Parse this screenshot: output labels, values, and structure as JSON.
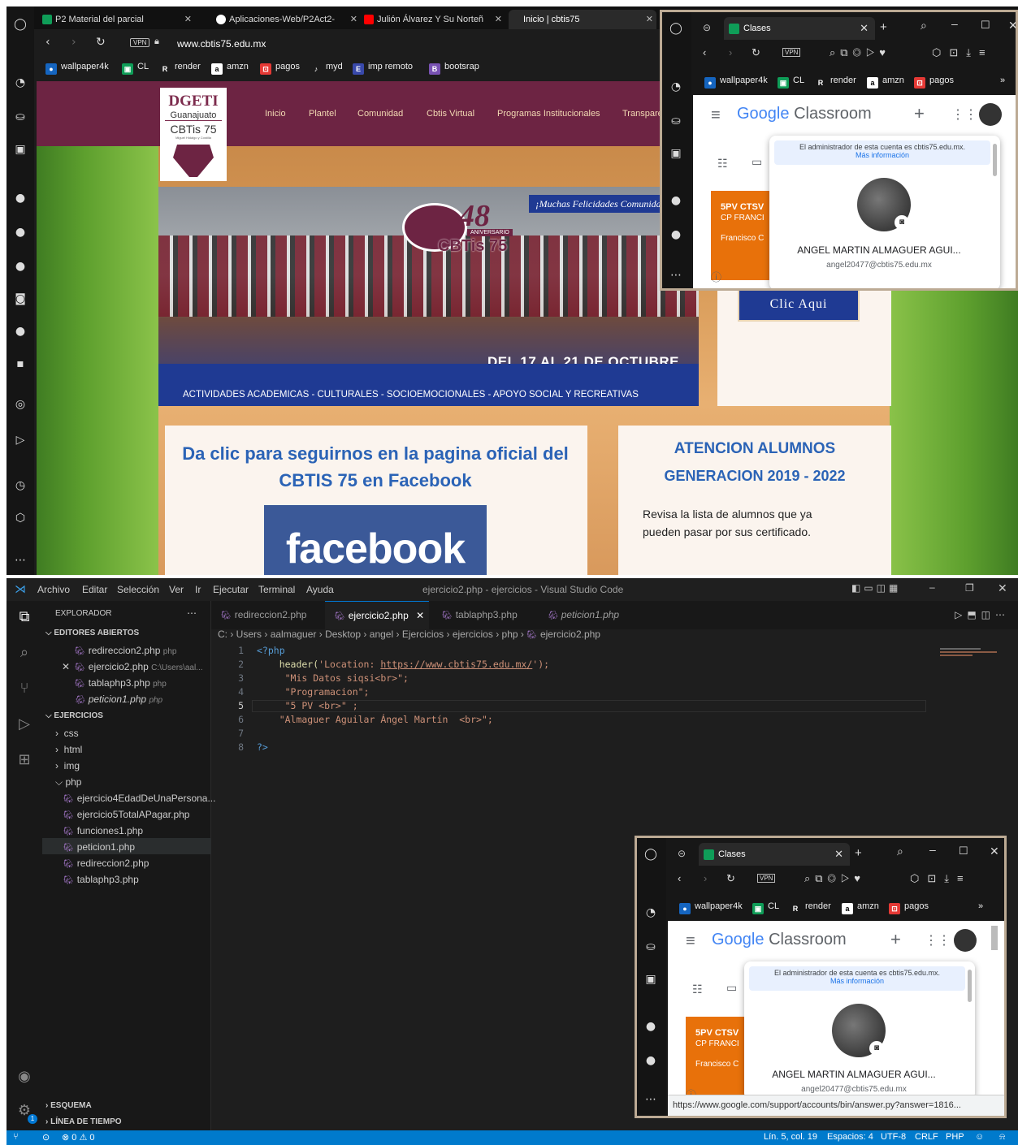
{
  "browser": {
    "tabs": [
      {
        "label": "P2 Material del parcial"
      },
      {
        "label": "Aplicaciones-Web/P2Act2-"
      },
      {
        "label": "Julión Álvarez Y Su Norteñ"
      },
      {
        "label": "Inicio | cbtis75"
      }
    ],
    "vpn": "VPN",
    "url": "www.cbtis75.edu.mx",
    "bookmarks": [
      "wallpaper4k",
      "CL",
      "render",
      "amzn",
      "pagos",
      "myd",
      "imp remoto",
      "bootsrap"
    ]
  },
  "site": {
    "logo_line1": "DGETI",
    "logo_line2": "Guanajuato",
    "logo_line3": "CBTis 75",
    "logo_line4": "Miguel Hidalgo y Costilla",
    "nav": [
      "Inicio",
      "Plantel",
      "Comunidad",
      "Cbtis Virtual",
      "Programas Institucionales",
      "Transpare"
    ],
    "banner_script": "¡Muchas Felicidades Comunidad",
    "banner_badge_number": "48",
    "banner_badge_text": "ANIVERSARIO",
    "banner_badge_school": "CBTis 75",
    "banner_dates": "DEL 17 AL 21 DE OCTUBRE",
    "banner_strip": "ACTIVIDADES ACADEMICAS - CULTURALES - SOCIOEMOCIONALES - APOYO SOCIAL Y RECREATIVAS",
    "clic_button": "Clic Aqui",
    "facebook_card_title": "Da clic para seguirnos en la pagina oficial del CBTIS 75 en Facebook",
    "facebook_logo": "facebook",
    "alumnos_title_1": "ATENCION ALUMNOS",
    "alumnos_title_2": "GENERACION 2019 - 2022",
    "alumnos_text": "Revisa la lista de alumnos que ya pueden pasar por sus certificado."
  },
  "mini_top": {
    "tab": "Clases",
    "vpn": "VPN",
    "bookmarks": [
      "wallpaper4k",
      "CL",
      "render",
      "amzn",
      "pagos"
    ],
    "app_google": "Google",
    "app_name": "Classroom",
    "admin_notice": "El administrador de esta cuenta es cbtis75.edu.mx.",
    "more_info": "Más información",
    "card_line1": "5PV CTSV",
    "card_line2": "CP FRANCI",
    "card_line3": "Francisco C",
    "user_name": "ANGEL MARTIN ALMAGUER AGUI...",
    "user_email": "angel20477@cbtis75.edu.mx"
  },
  "mini_bottom": {
    "tab": "Clases",
    "vpn": "VPN",
    "bookmarks": [
      "wallpaper4k",
      "CL",
      "render",
      "amzn",
      "pagos"
    ],
    "app_google": "Google",
    "app_name": "Classroom",
    "admin_notice": "El administrador de esta cuenta es cbtis75.edu.mx.",
    "more_info": "Más información",
    "card_line1": "5PV CTSV",
    "card_line2": "CP FRANCI",
    "card_line3": "Francisco C",
    "user_name": "ANGEL MARTIN ALMAGUER AGUI...",
    "user_email": "angel20477@cbtis75.edu.mx",
    "status_url": "https://www.google.com/support/accounts/bin/answer.py?answer=1816..."
  },
  "vscode": {
    "menu": [
      "Archivo",
      "Editar",
      "Selección",
      "Ver",
      "Ir",
      "Ejecutar",
      "Terminal",
      "Ayuda"
    ],
    "window_title": "ejercicio2.php - ejercicios - Visual Studio Code",
    "explorer_title": "EXPLORADOR",
    "open_editors_title": "EDITORES ABIERTOS",
    "open_editors": [
      {
        "name": "redireccion2.php",
        "hint": "php"
      },
      {
        "name": "ejercicio2.php",
        "hint": "C:\\Users\\aal..."
      },
      {
        "name": "tablaphp3.php",
        "hint": "php"
      },
      {
        "name": "peticion1.php",
        "hint": "php"
      }
    ],
    "folder_title": "EJERCICIOS",
    "folders": [
      "css",
      "html",
      "img",
      "php"
    ],
    "php_files": [
      "ejercicio4EdadDeUnaPersona...",
      "ejercicio5TotalAPagar.php",
      "funciones1.php",
      "peticion1.php",
      "redireccion2.php",
      "tablaphp3.php"
    ],
    "outline": "ESQUEMA",
    "timeline": "LÍNEA DE TIEMPO",
    "tabs": [
      "redireccion2.php",
      "ejercicio2.php",
      "tablaphp3.php",
      "peticion1.php"
    ],
    "breadcrumb": [
      "C:",
      "Users",
      "aalmaguer",
      "Desktop",
      "angel",
      "Ejercicios",
      "ejercicios",
      "php",
      "ejercicio2.php"
    ],
    "code_lines": [
      {
        "n": "1",
        "text": "<?php"
      },
      {
        "n": "2",
        "pre": "    header(",
        "str": "'Location: ",
        "url": "https://www.cbtis75.edu.mx/",
        "post": "');"
      },
      {
        "n": "3",
        "text": "     \"Mis Datos siqsi<br>\";"
      },
      {
        "n": "4",
        "text": "     \"Programacion\";"
      },
      {
        "n": "5",
        "text": "     \"5 PV <br>\" ;"
      },
      {
        "n": "6",
        "text": "    \"Almaguer Aguilar Ángel Martín  <br>\";"
      },
      {
        "n": "7",
        "text": ""
      },
      {
        "n": "8",
        "text": "?>"
      }
    ],
    "status": {
      "errors": "0",
      "warnings": "0",
      "position": "Lín. 5, col. 19",
      "spaces": "Espacios: 4",
      "encoding": "UTF-8",
      "eol": "CRLF",
      "language": "PHP"
    },
    "badge": "1"
  },
  "colors": {
    "site_wine": "#7c2b4d",
    "vscode_blue": "#007acc",
    "php_purple": "#a074c4",
    "classroom_orange": "#e8710a"
  }
}
